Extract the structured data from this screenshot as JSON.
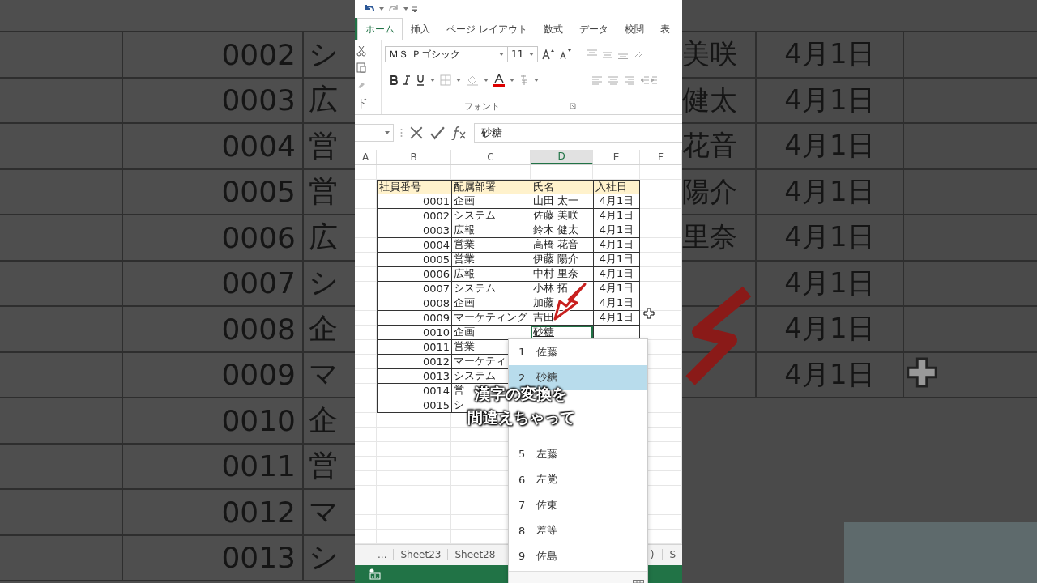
{
  "backdrop_left": {
    "rows": [
      {
        "id": "0002",
        "dept": "シ"
      },
      {
        "id": "0003",
        "dept": "広"
      },
      {
        "id": "0004",
        "dept": "営"
      },
      {
        "id": "0005",
        "dept": "営"
      },
      {
        "id": "0006",
        "dept": "広"
      },
      {
        "id": "0007",
        "dept": "シ"
      },
      {
        "id": "0008",
        "dept": "企"
      },
      {
        "id": "0009",
        "dept": "マ"
      },
      {
        "id": "0010",
        "dept": "企"
      },
      {
        "id": "0011",
        "dept": "営"
      },
      {
        "id": "0012",
        "dept": "マ"
      },
      {
        "id": "0013",
        "dept": "シ"
      }
    ]
  },
  "ribbon": {
    "tabs": [
      {
        "label": "ホーム",
        "selected": true
      },
      {
        "label": "挿入",
        "selected": false
      },
      {
        "label": "ページ レイアウト",
        "selected": false
      },
      {
        "label": "数式",
        "selected": false
      },
      {
        "label": "データ",
        "selected": false
      },
      {
        "label": "校閲",
        "selected": false
      },
      {
        "label": "表",
        "selected": false
      }
    ],
    "clipboard_label": "ド",
    "font_name": "ＭＳ Ｐゴシック",
    "font_size": "11",
    "font_group_label": "フォント"
  },
  "formula_bar": {
    "value": "砂糖"
  },
  "columns": [
    {
      "label": "A",
      "selected": false
    },
    {
      "label": "B",
      "selected": false
    },
    {
      "label": "C",
      "selected": false
    },
    {
      "label": "D",
      "selected": true
    },
    {
      "label": "E",
      "selected": false
    },
    {
      "label": "F",
      "selected": false
    }
  ],
  "table": {
    "headers": [
      "社員番号",
      "配属部署",
      "氏名",
      "入社日"
    ],
    "rows": [
      {
        "id": "0001",
        "dept": "企画",
        "name": "山田 太一",
        "date": "4月1日",
        "editing": false
      },
      {
        "id": "0002",
        "dept": "システム",
        "name": "佐藤 美咲",
        "date": "4月1日",
        "editing": false
      },
      {
        "id": "0003",
        "dept": "広報",
        "name": "鈴木 健太",
        "date": "4月1日",
        "editing": false
      },
      {
        "id": "0004",
        "dept": "営業",
        "name": "高橋 花音",
        "date": "4月1日",
        "editing": false
      },
      {
        "id": "0005",
        "dept": "営業",
        "name": "伊藤 陽介",
        "date": "4月1日",
        "editing": false
      },
      {
        "id": "0006",
        "dept": "広報",
        "name": "中村 里奈",
        "date": "4月1日",
        "editing": false
      },
      {
        "id": "0007",
        "dept": "システム",
        "name": "小林 拓",
        "date": "4月1日",
        "editing": false
      },
      {
        "id": "0008",
        "dept": "企画",
        "name": "加藤",
        "date": "4月1日",
        "editing": false
      },
      {
        "id": "0009",
        "dept": "マーケティング",
        "name": "吉田",
        "date": "4月1日",
        "editing": false
      },
      {
        "id": "0010",
        "dept": "企画",
        "name": "砂糖",
        "editing": true
      },
      {
        "id": "0011",
        "dept": "営業"
      },
      {
        "id": "0012",
        "dept": "マーケティ"
      },
      {
        "id": "0013",
        "dept": "システム"
      },
      {
        "id": "0014",
        "dept": "営"
      },
      {
        "id": "0015",
        "dept": "シ"
      }
    ]
  },
  "ime_candidates": [
    {
      "kind": "candidate",
      "number": "1",
      "text": "佐藤",
      "selected": false
    },
    {
      "kind": "candidate",
      "number": "2",
      "text": "砂糖",
      "selected": true
    },
    {
      "kind": "covered"
    },
    {
      "kind": "covered"
    },
    {
      "kind": "candidate",
      "number": "5",
      "text": "左藤",
      "selected": false
    },
    {
      "kind": "candidate",
      "number": "6",
      "text": "左党",
      "selected": false
    },
    {
      "kind": "candidate",
      "number": "7",
      "text": "佐東",
      "selected": false
    },
    {
      "kind": "candidate",
      "number": "8",
      "text": "差等",
      "selected": false
    },
    {
      "kind": "candidate",
      "number": "9",
      "text": "佐島",
      "selected": false
    }
  ],
  "sheet_tabs": {
    "overflow": "...",
    "tabs": [
      "Sheet23",
      "Sheet28"
    ],
    "trailing": [
      ")",
      "S"
    ]
  },
  "caption": [
    "漢字の変換を",
    "間違えちゃって"
  ],
  "backdrop_right": {
    "rows": [
      {
        "name": "美咲",
        "date": "4月1日"
      },
      {
        "name": "健太",
        "date": "4月1日"
      },
      {
        "name": "花音",
        "date": "4月1日"
      },
      {
        "name": "陽介",
        "date": "4月1日"
      },
      {
        "name": "里奈",
        "date": "4月1日"
      },
      {
        "date": "4月1日"
      },
      {
        "date": "4月1日"
      },
      {
        "date": "4月1日"
      }
    ]
  }
}
